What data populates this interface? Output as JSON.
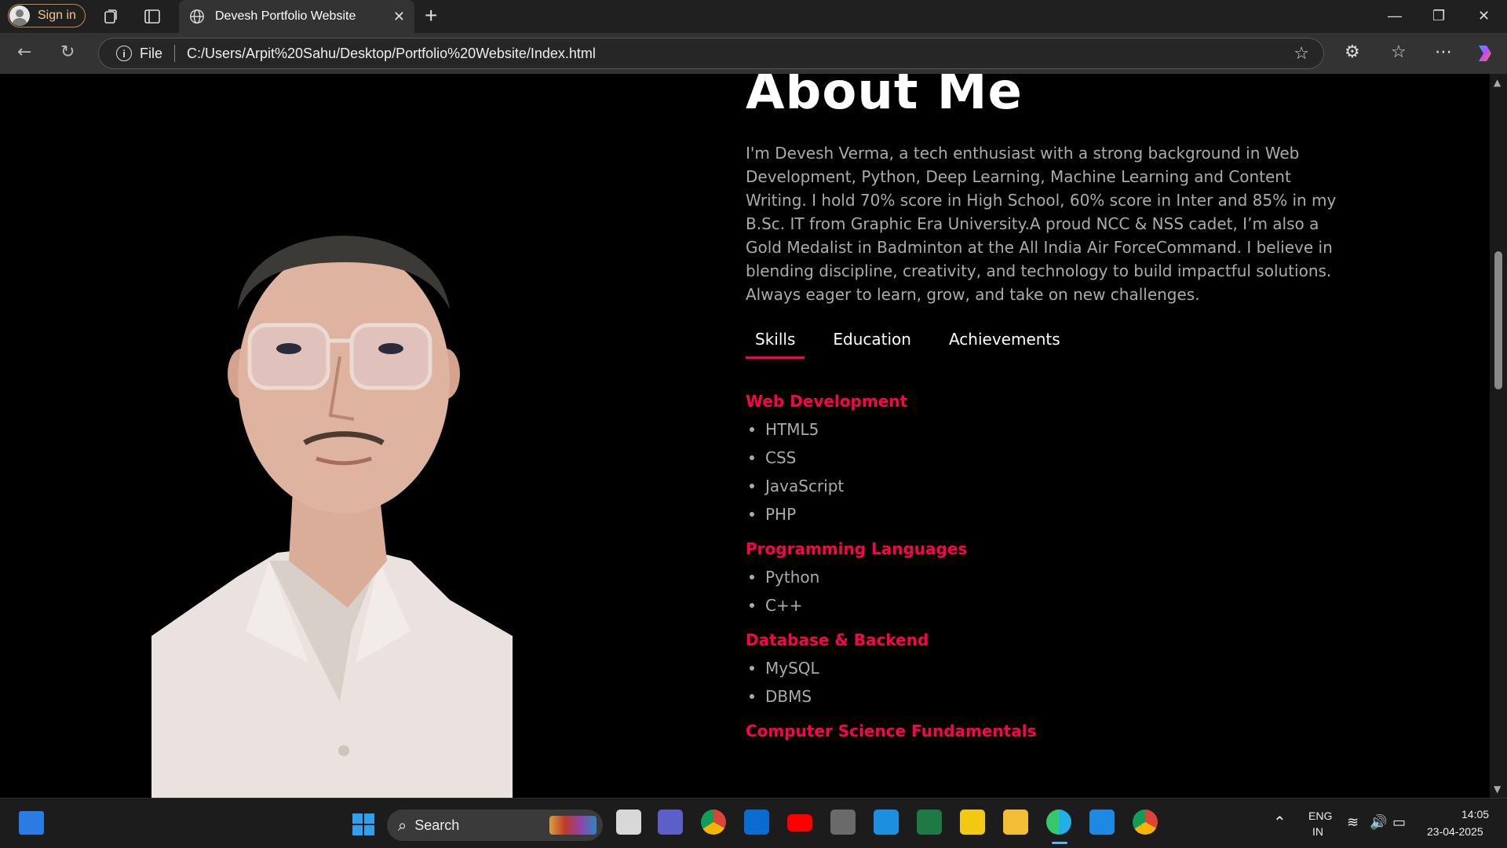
{
  "browser": {
    "signin_label": "Sign in",
    "tab_title": "Devesh Portfolio Website",
    "address_scheme": "File",
    "address_url": "C:/Users/Arpit%20Sahu/Desktop/Portfolio%20Website/Index.html"
  },
  "about": {
    "heading": "About Me",
    "bio": "I'm Devesh Verma, a tech enthusiast with a strong background in Web Development, Python, Deep Learning, Machine Learning and Content Writing. I hold 70% score in High School, 60% score in Inter and 85% in my B.Sc. IT from Graphic Era University.A proud NCC & NSS cadet, I’m also a Gold Medalist in Badminton at the All India Air ForceCommand. I believe in blending discipline, creativity, and technology to build impactful solutions. Always eager to learn, grow, and take on new challenges.",
    "tabs": [
      "Skills",
      "Education",
      "Achievements"
    ],
    "active_tab": "Skills",
    "skills": [
      {
        "category": "Web Development",
        "items": [
          "HTML5",
          "CSS",
          "JavaScript",
          "PHP"
        ]
      },
      {
        "category": "Programming Languages",
        "items": [
          "Python",
          "C++"
        ]
      },
      {
        "category": "Database & Backend",
        "items": [
          "MySQL",
          "DBMS"
        ]
      },
      {
        "category": "Computer Science Fundamentals",
        "items": []
      }
    ],
    "accent_color": "#ff004f"
  },
  "taskbar": {
    "search_label": "Search",
    "lang_top": "ENG",
    "lang_bottom": "IN",
    "time": "14:05",
    "date": "23-04-2025"
  }
}
